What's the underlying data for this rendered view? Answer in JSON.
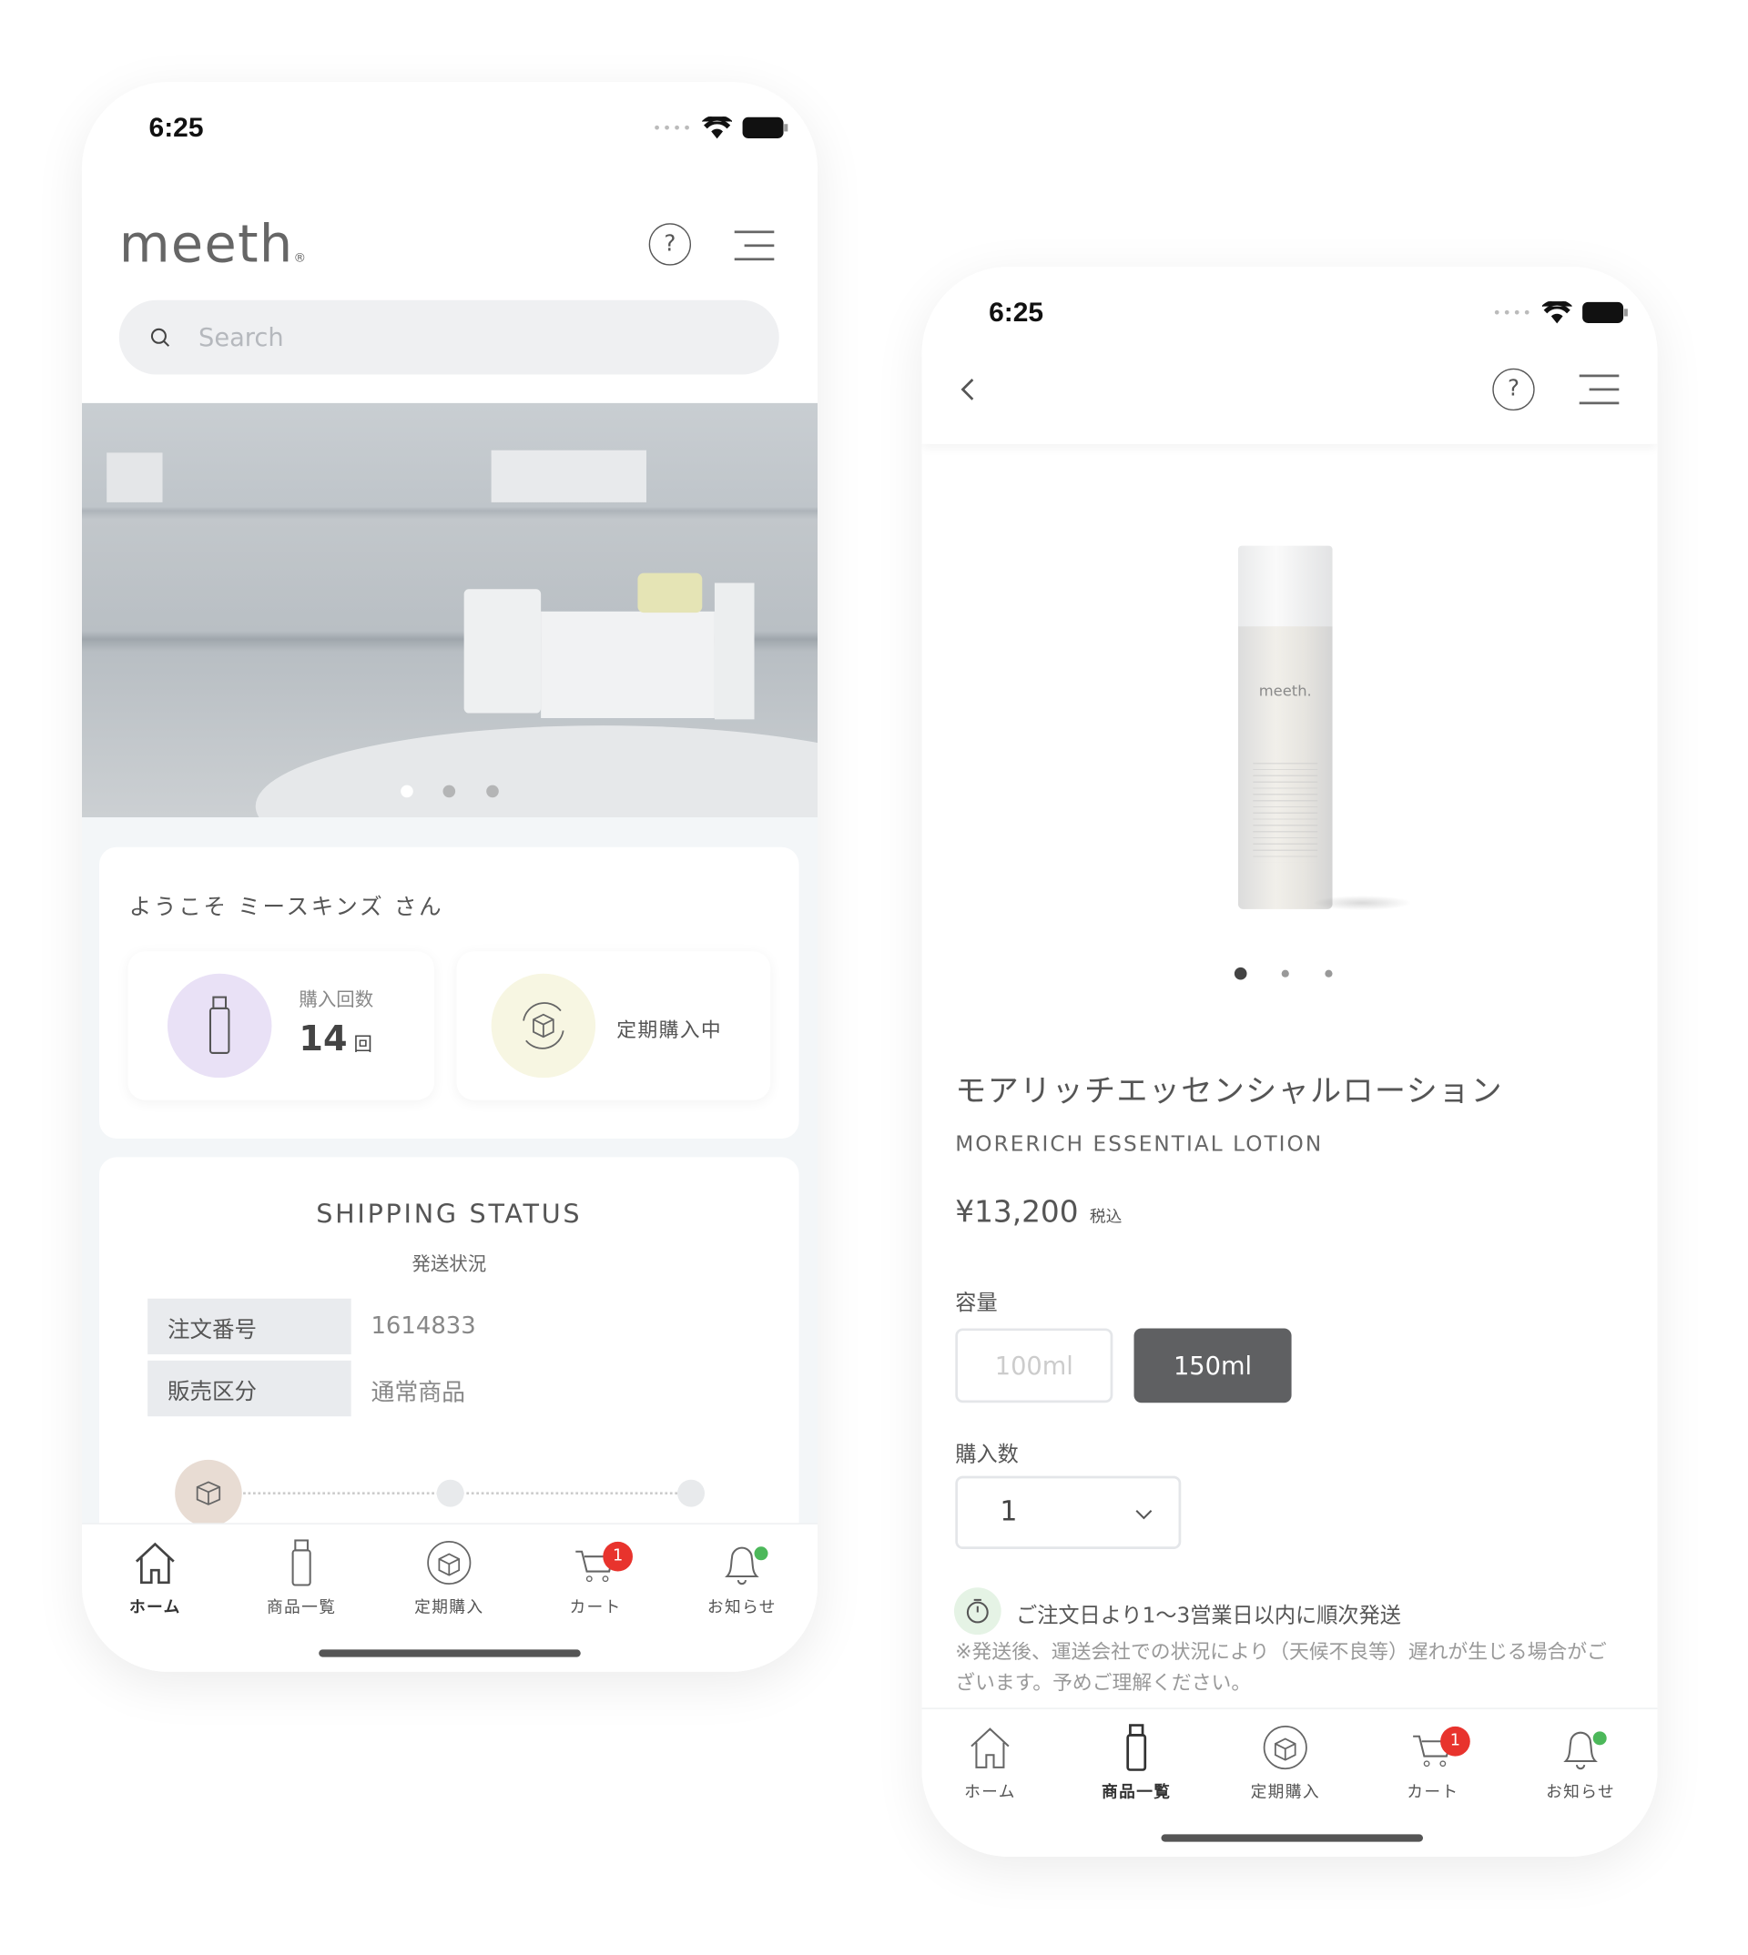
{
  "home": {
    "status": {
      "time": "6:25"
    },
    "logo": "meeth",
    "search": {
      "placeholder": "Search"
    },
    "carousel": {
      "total": 3,
      "active": 1
    },
    "welcome": "ようこそ ミースキンズ さん",
    "stats": {
      "purchase_label": "購入回数",
      "purchase_count": "14",
      "purchase_unit": "回",
      "subscription": "定期購入中"
    },
    "shipping": {
      "title": "SHIPPING STATUS",
      "subtitle": "発送状況",
      "rows": [
        {
          "label": "注文番号",
          "value": "1614833"
        },
        {
          "label": "販売区分",
          "value": "通常商品"
        }
      ]
    }
  },
  "product": {
    "status": {
      "time": "6:25"
    },
    "carousel": {
      "total": 3,
      "active": 1
    },
    "name_ja": "モアリッチエッセンシャルローション",
    "name_en": "MORERICH ESSENTIAL LOTION",
    "price": "¥13,200",
    "tax": "税込",
    "capacity_label": "容量",
    "capacity_options": [
      "100ml",
      "150ml"
    ],
    "capacity_selected": "150ml",
    "quantity_label": "購入数",
    "quantity": "1",
    "delivery": "ご注文日より1〜3営業日以内に順次発送",
    "delivery_note": "※発送後、運送会社での状況により（天候不良等）遅れが生じる場合がございます。予めご理解ください。",
    "bottle_brand": "meeth."
  },
  "tabs": [
    {
      "label": "ホーム",
      "icon": "home-icon"
    },
    {
      "label": "商品一覧",
      "icon": "bottle-icon"
    },
    {
      "label": "定期購入",
      "icon": "subscription-box-icon"
    },
    {
      "label": "カート",
      "icon": "cart-icon",
      "badge": "1"
    },
    {
      "label": "お知らせ",
      "icon": "bell-icon"
    }
  ],
  "colors": {
    "accent_dark": "#5f6062",
    "badge": "#e8332d",
    "notify_dot": "#4cb85a",
    "purple_circle": "#e9e1f6",
    "yellow_circle": "#f7f6e2",
    "progress_active": "#e8dcd3"
  }
}
